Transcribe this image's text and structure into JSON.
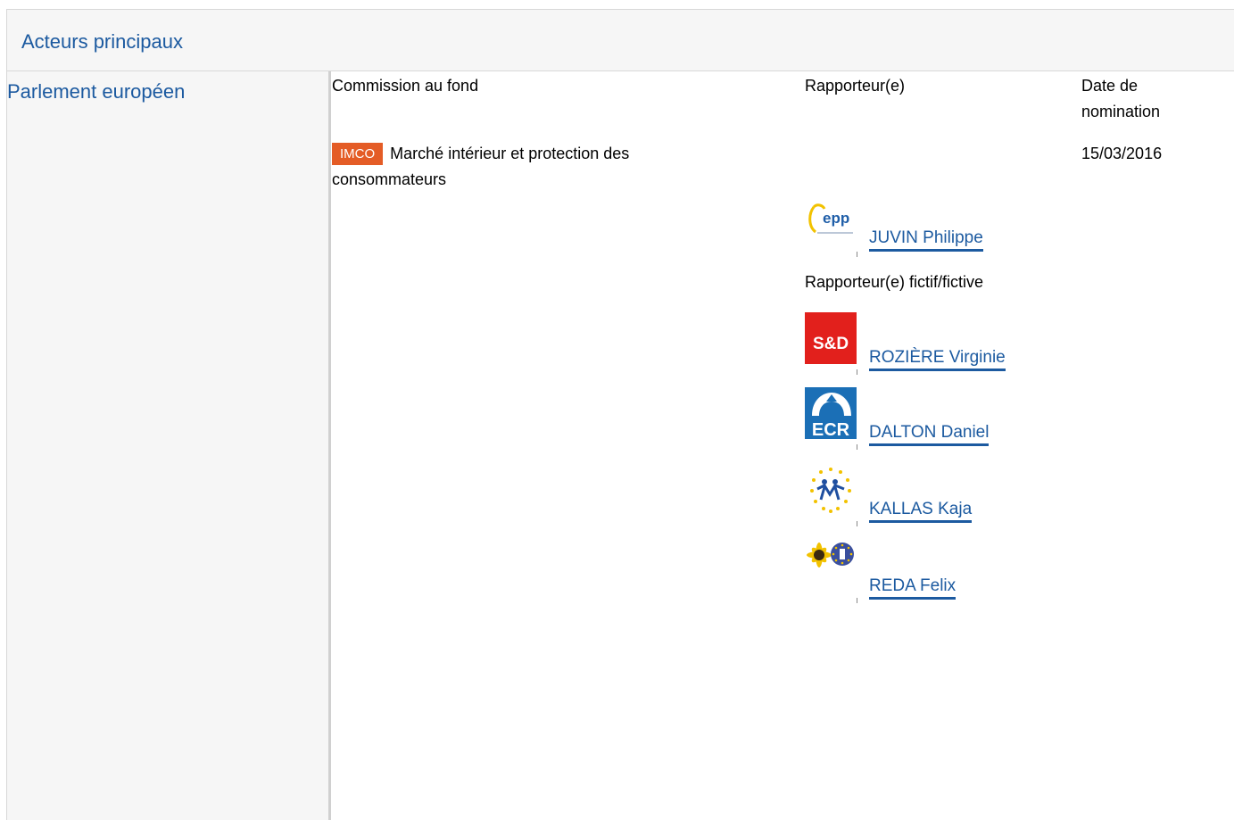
{
  "panel": {
    "title": "Acteurs principaux"
  },
  "institution": {
    "name": "Parlement européen"
  },
  "columns": {
    "committee": "Commission au fond",
    "rapporteur": "Rapporteur(e)",
    "date": "Date de nomination"
  },
  "committee": {
    "code": "IMCO",
    "name": "Marché intérieur et protection des consommateurs",
    "badge_color": "#e45c26"
  },
  "nomination_date": "15/03/2016",
  "rapporteurs": [
    {
      "name": "JUVIN Philippe",
      "group_logo": "epp-logo"
    }
  ],
  "shadow_label": "Rapporteur(e) fictif/fictive",
  "shadow_rapporteurs": [
    {
      "name": "ROZIÈRE Virginie",
      "group_logo": "s-and-d-logo",
      "logo_text": "S&D"
    },
    {
      "name": "DALTON Daniel",
      "group_logo": "ecr-logo",
      "logo_text": "ECR"
    },
    {
      "name": "KALLAS Kaja",
      "group_logo": "alde-logo"
    },
    {
      "name": "REDA Felix",
      "group_logo": "greens-efa-logo"
    }
  ],
  "colors": {
    "link": "#1c5aa0",
    "panel_bg": "#f6f6f6",
    "s_and_d_red": "#e2201c",
    "ecr_blue": "#1b6fb6"
  }
}
